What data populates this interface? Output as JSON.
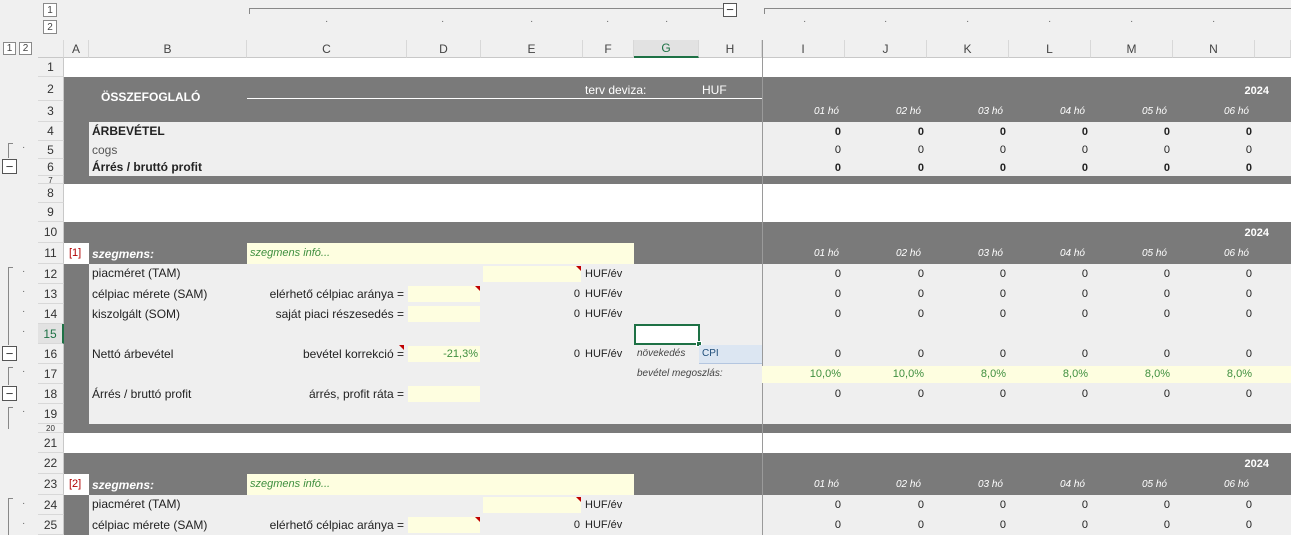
{
  "outline": {
    "column_levels": [
      "1",
      "2"
    ],
    "row_levels": [
      "1",
      "2"
    ],
    "collapse_symbol": "−"
  },
  "columns": [
    "A",
    "B",
    "C",
    "D",
    "E",
    "F",
    "G",
    "H",
    "I",
    "J",
    "K",
    "L",
    "M",
    "N"
  ],
  "rows": [
    "1",
    "2",
    "3",
    "4",
    "5",
    "6",
    "7",
    "8",
    "9",
    "10",
    "11",
    "12",
    "13",
    "14",
    "15",
    "16",
    "17",
    "18",
    "19",
    "20",
    "21",
    "22",
    "23",
    "24",
    "25"
  ],
  "summary": {
    "title": "ÖSSZEFOGLALÓ",
    "currency_label": "terv deviza:",
    "currency_value": "HUF",
    "year": "2024",
    "months": [
      "01 hó",
      "02 hó",
      "03 hó",
      "04 hó",
      "05 hó",
      "06 hó"
    ],
    "lines": [
      {
        "label": "ÁRBEVÉTEL",
        "values": [
          "0",
          "0",
          "0",
          "0",
          "0",
          "0"
        ]
      },
      {
        "label": "cogs",
        "values": [
          "0",
          "0",
          "0",
          "0",
          "0",
          "0"
        ]
      },
      {
        "label": "Árrés / bruttó profit",
        "values": [
          "0",
          "0",
          "0",
          "0",
          "0",
          "0"
        ]
      }
    ]
  },
  "segment1": {
    "tag": "[1]",
    "name": "szegmens:",
    "info": "szegmens infó...",
    "year": "2024",
    "months": [
      "01 hó",
      "02 hó",
      "03 hó",
      "04 hó",
      "05 hó",
      "06 hó"
    ],
    "tam": {
      "label": "piacméret (TAM)",
      "unit": "HUF/év",
      "values": [
        "0",
        "0",
        "0",
        "0",
        "0",
        "0"
      ]
    },
    "sam": {
      "label": "célpiac mérete (SAM)",
      "param": "elérhető célpiac aránya =",
      "value": "0",
      "unit": "HUF/év",
      "values": [
        "0",
        "0",
        "0",
        "0",
        "0",
        "0"
      ]
    },
    "som": {
      "label": "kiszolgált (SOM)",
      "param": "saját piaci részesedés =",
      "value": "0",
      "unit": "HUF/év",
      "values": [
        "0",
        "0",
        "0",
        "0",
        "0",
        "0"
      ]
    },
    "net": {
      "label": "Nettó árbevétel",
      "param": "bevétel korrekció =",
      "pct": "-21,3%",
      "value": "0",
      "unit": "HUF/év",
      "growth_label": "növekedés",
      "growth_value": "CPI",
      "values": [
        "0",
        "0",
        "0",
        "0",
        "0",
        "0"
      ]
    },
    "split": {
      "label": "bevétel megoszlás:",
      "values": [
        "10,0%",
        "10,0%",
        "8,0%",
        "8,0%",
        "8,0%",
        "8,0%"
      ]
    },
    "margin": {
      "label": "Árrés / bruttó profit",
      "param": "árrés, profit ráta =",
      "values": [
        "0",
        "0",
        "0",
        "0",
        "0",
        "0"
      ]
    }
  },
  "segment2": {
    "tag": "[2]",
    "name": "szegmens:",
    "info": "szegmens infó...",
    "year": "2024",
    "months": [
      "01 hó",
      "02 hó",
      "03 hó",
      "04 hó",
      "05 hó",
      "06 hó"
    ],
    "tam": {
      "label": "piacméret (TAM)",
      "unit": "HUF/év",
      "values": [
        "0",
        "0",
        "0",
        "0",
        "0",
        "0"
      ]
    },
    "sam": {
      "label": "célpiac mérete (SAM)",
      "param": "elérhető célpiac aránya =",
      "value": "0",
      "unit": "HUF/év",
      "values": [
        "0",
        "0",
        "0",
        "0",
        "0",
        "0"
      ]
    }
  }
}
